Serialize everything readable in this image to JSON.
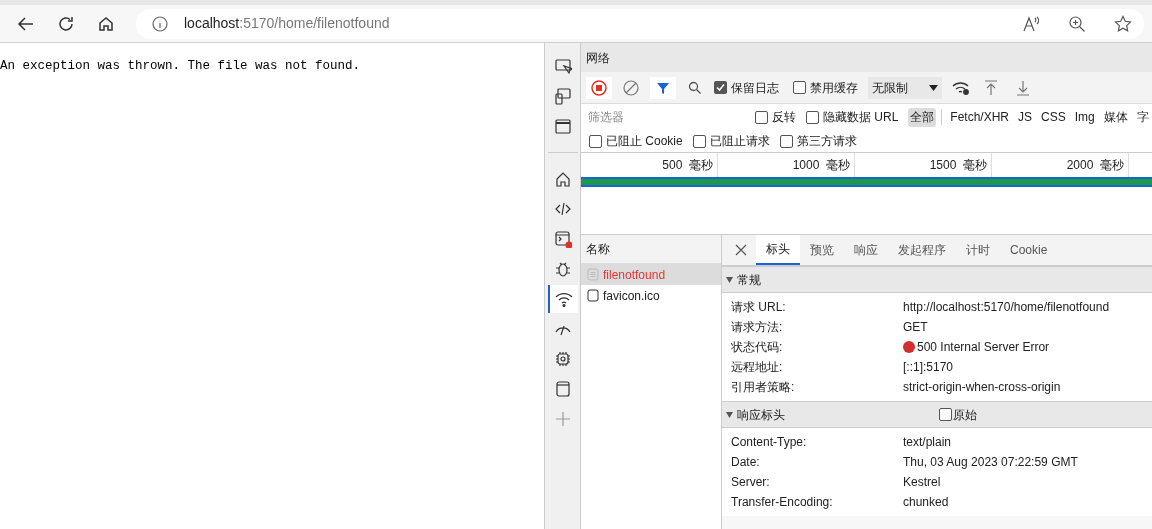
{
  "address_bar": {
    "host": "localhost",
    "path": ":5170/home/filenotfound"
  },
  "page_text": "An exception was thrown. The file was not found.",
  "devtools": {
    "sidebar": [
      {
        "kind": "inspect",
        "selected": false
      },
      {
        "kind": "device",
        "selected": false
      },
      {
        "kind": "window",
        "selected": false
      },
      {
        "kind": "home",
        "selected": false
      },
      {
        "kind": "code",
        "selected": false
      },
      {
        "kind": "console",
        "selected": false
      },
      {
        "kind": "bug",
        "selected": false
      },
      {
        "kind": "wifi",
        "selected": true
      },
      {
        "kind": "gauge",
        "selected": false
      },
      {
        "kind": "chip",
        "selected": false
      },
      {
        "kind": "panel",
        "selected": false
      },
      {
        "kind": "plus",
        "selected": false
      }
    ],
    "panel_title": "网络",
    "toolbar": {
      "recording": true,
      "preserve_log": {
        "label": "保留日志",
        "checked": true
      },
      "disable_cache": {
        "label": "禁用缓存",
        "checked": false
      },
      "throttle": "无限制"
    },
    "filter": {
      "placeholder": "筛选器",
      "invert": {
        "label": "反转",
        "checked": false
      },
      "hide_data_urls": {
        "label": "隐藏数据 URL",
        "checked": false
      },
      "types": [
        {
          "label": "全部",
          "selected": true
        },
        {
          "label": "Fetch/XHR",
          "selected": false
        },
        {
          "label": "JS",
          "selected": false
        },
        {
          "label": "CSS",
          "selected": false
        },
        {
          "label": "Img",
          "selected": false
        },
        {
          "label": "媒体",
          "selected": false
        },
        {
          "label": "字",
          "selected": false
        }
      ],
      "blocks": [
        {
          "label": "已阻止 Cookie",
          "checked": false
        },
        {
          "label": "已阻止请求",
          "checked": false
        },
        {
          "label": "第三方请求",
          "checked": false
        }
      ]
    },
    "timeline_ticks": [
      "500  毫秒",
      "1000  毫秒",
      "1500  毫秒",
      "2000  毫秒"
    ],
    "name_column": "名称",
    "requests": [
      {
        "name": "filenotfound",
        "selected": true,
        "failed": true
      },
      {
        "name": "favicon.ico",
        "selected": false,
        "failed": false
      }
    ],
    "detail_tabs": [
      {
        "label": "标头",
        "selected": true
      },
      {
        "label": "预览",
        "selected": false
      },
      {
        "label": "响应",
        "selected": false
      },
      {
        "label": "发起程序",
        "selected": false
      },
      {
        "label": "计时",
        "selected": false
      },
      {
        "label": "Cookie",
        "selected": false
      }
    ],
    "sections": [
      {
        "title": "常规",
        "expanded": true,
        "rows": [
          {
            "name": "请求 URL:",
            "value": "http://localhost:5170/home/filenotfound"
          },
          {
            "name": "请求方法:",
            "value": "GET"
          },
          {
            "name": "状态代码:",
            "value": "500 Internal Server Error",
            "color": "#d32f2f"
          },
          {
            "name": "远程地址:",
            "value": "[::1]:5170"
          },
          {
            "name": "引用者策略:",
            "value": "strict-origin-when-cross-origin"
          }
        ]
      },
      {
        "title": "响应标头",
        "expanded": true,
        "raw": {
          "label": "原始",
          "checked": false
        },
        "rows": [
          {
            "name": "Content-Type:",
            "value": "text/plain"
          },
          {
            "name": "Date:",
            "value": "Thu, 03 Aug 2023 07:22:59 GMT"
          },
          {
            "name": "Server:",
            "value": "Kestrel"
          },
          {
            "name": "Transfer-Encoding:",
            "value": "chunked"
          }
        ]
      }
    ]
  }
}
